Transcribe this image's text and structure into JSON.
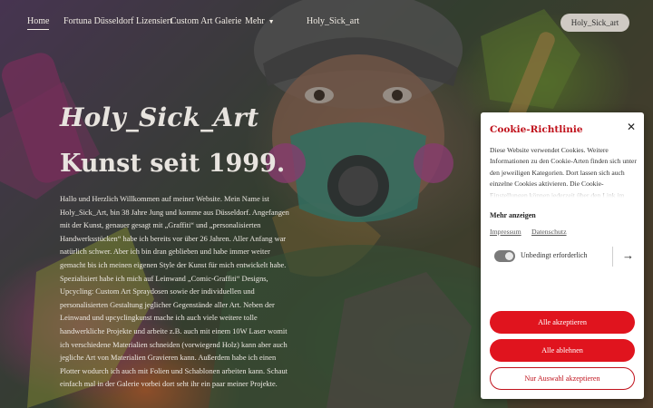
{
  "nav": {
    "items": [
      {
        "label": "Home",
        "active": true
      },
      {
        "label": "Fortuna Düsseldorf Lizensiert",
        "active": false
      },
      {
        "label": "Custom Art Galerie",
        "active": false
      },
      {
        "label": "Mehr",
        "active": false,
        "has_dropdown": true
      }
    ],
    "brand": "Holy_Sick_art",
    "pill_label": "Holy_Sick_art"
  },
  "hero": {
    "title": "Holy_Sick_Art",
    "subtitle": "Kunst seit 1999.",
    "body": "Hallo und Herzlich Willkommen auf meiner Website. Mein Name ist Holy_Sick_Art, bin 38 Jahre Jung und komme aus Düsseldorf. Angefangen mit der Kunst, genauer gesagt mit „Graffiti“ und „personalisierten Handwerksstücken“ habe ich bereits vor über 26 Jahren. Aller Anfang war natürlich schwer. Aber ich bin dran geblieben und habe immer weiter gemacht bis ich meinen eigenen Style der Kunst für mich entwickelt habe. Spezialisiert habe ich mich auf Leinwand „Comic-Graffiti“ Designs, Upcycling: Custom Art Spraydosen sowie der individuellen und personalisierten Gestaltung jeglicher Gegenstände aller Art. Neben der Leinwand und upcyclingkunst mache ich auch viele weitere tolle handwerkliche Projekte und arbeite z.B. auch mit einem 10W Laser womit ich verschiedene Materialien schneiden (vorwiegend Holz) kann aber auch jegliche Art von Materialien Gravieren kann. Außerdem habe ich einen Plotter wodurch ich auch mit Folien und Schablonen arbeiten kann. Schaut einfach mal in der Galerie vorbei dort seht ihr ein paar meiner Projekte."
  },
  "cookie": {
    "title": "Cookie-Richtlinie",
    "close_icon": "close-icon",
    "text": "Diese Website verwendet Cookies. Weitere Informationen zu den Cookie-Arten finden sich unter den jeweiligen Kategorien. Dort lassen sich auch einzelne Cookies aktivieren. Die Cookie-Einstellungen können jederzeit über den Link im",
    "show_more": "Mehr anzeigen",
    "links": [
      "Impressum",
      "Datenschutz"
    ],
    "category": {
      "label": "Unbedingt erforderlich",
      "enabled": true
    },
    "buttons": {
      "accept_all": "Alle akzeptieren",
      "reject_all": "Alle ablehnen",
      "accept_selection": "Nur Auswahl akzeptieren"
    }
  },
  "colors": {
    "accent": "#e0141e",
    "title_red": "#c0121c",
    "nav_text": "#f1ece4",
    "pill_bg": "#cfcac4"
  }
}
